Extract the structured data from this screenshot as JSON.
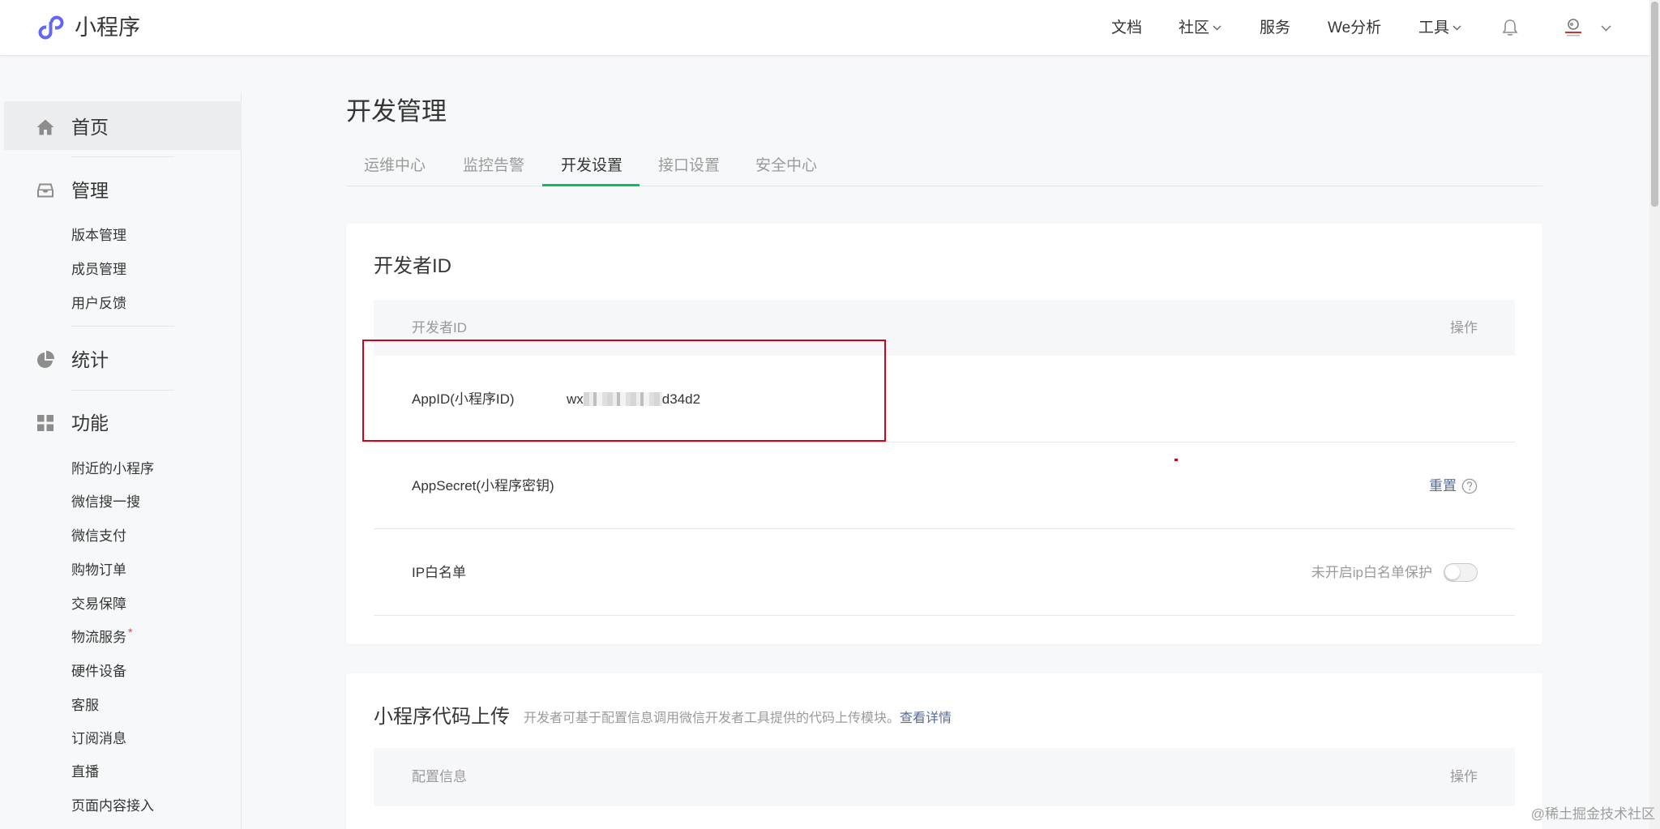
{
  "header": {
    "brand": "小程序",
    "logo_icon": "mini-program-logo",
    "nav": [
      {
        "label": "文档",
        "dropdown": false
      },
      {
        "label": "社区",
        "dropdown": true
      },
      {
        "label": "服务",
        "dropdown": false
      },
      {
        "label": "We分析",
        "dropdown": false
      },
      {
        "label": "工具",
        "dropdown": true
      }
    ],
    "notification_icon": "bell-icon",
    "account_icon": "avatar",
    "account_menu_icon": "chevron-down-icon"
  },
  "sidebar": {
    "groups": [
      {
        "label": "首页",
        "icon": "home-icon",
        "active": true,
        "items": []
      },
      {
        "label": "管理",
        "icon": "inbox-icon",
        "items": [
          {
            "label": "版本管理"
          },
          {
            "label": "成员管理"
          },
          {
            "label": "用户反馈"
          }
        ]
      },
      {
        "label": "统计",
        "icon": "pie-chart-icon",
        "items": []
      },
      {
        "label": "功能",
        "icon": "grid-icon",
        "items": [
          {
            "label": "附近的小程序"
          },
          {
            "label": "微信搜一搜"
          },
          {
            "label": "微信支付"
          },
          {
            "label": "购物订单"
          },
          {
            "label": "交易保障"
          },
          {
            "label": "物流服务",
            "marker": "*"
          },
          {
            "label": "硬件设备"
          },
          {
            "label": "客服"
          },
          {
            "label": "订阅消息"
          },
          {
            "label": "直播"
          },
          {
            "label": "页面内容接入"
          }
        ]
      }
    ]
  },
  "page": {
    "title": "开发管理",
    "tabs": [
      {
        "label": "运维中心"
      },
      {
        "label": "监控告警"
      },
      {
        "label": "开发设置",
        "active": true
      },
      {
        "label": "接口设置"
      },
      {
        "label": "安全中心"
      }
    ]
  },
  "developer_id": {
    "title": "开发者ID",
    "columns": [
      "开发者ID",
      "操作"
    ],
    "rows": [
      {
        "label": "AppID(小程序ID)",
        "value_prefix": "wx",
        "value_suffix": "d34d2",
        "value_masked": true
      },
      {
        "label": "AppSecret(小程序密钥)",
        "action": "重置",
        "action_icon": "question-circle-icon"
      },
      {
        "label": "IP白名单",
        "status": "未开启ip白名单保护",
        "toggle_on": false
      }
    ]
  },
  "code_upload": {
    "title": "小程序代码上传",
    "description": "开发者可基于配置信息调用微信开发者工具提供的代码上传模块。",
    "link": "查看详情",
    "columns": [
      "配置信息",
      "操作"
    ]
  },
  "watermark": "@稀土掘金技术社区",
  "colors": {
    "accent_green": "#07c160",
    "link": "#576b95",
    "brand_logo": "#6467f0",
    "annotation_red": "#d0021b",
    "text": "#353535",
    "muted_text": "#9a9a9a",
    "page_background": "#f6f8f9"
  }
}
